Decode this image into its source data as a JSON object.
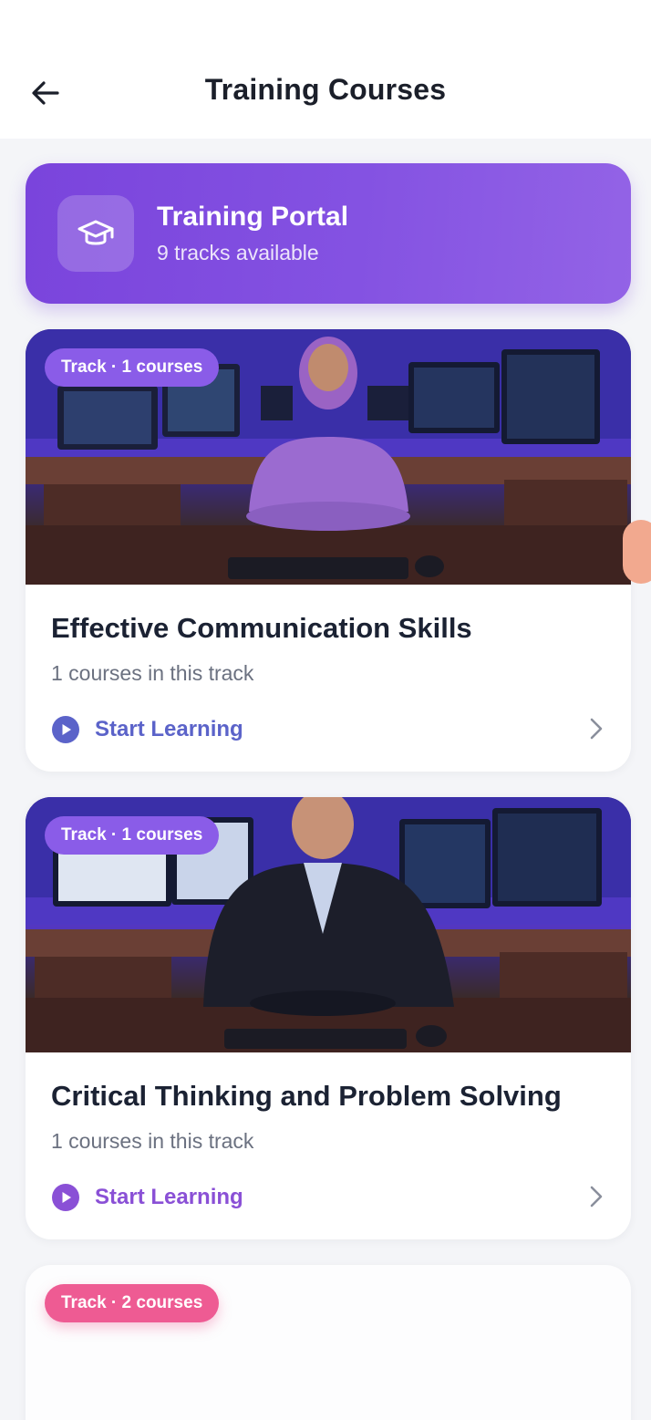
{
  "header": {
    "title": "Training Courses",
    "back_icon": "arrow-left-icon"
  },
  "portal": {
    "title": "Training Portal",
    "subtitle": "9 tracks available",
    "icon": "graduation-cap-icon",
    "color_start": "#7a44dc",
    "color_end": "#9363e6"
  },
  "tracks": [
    {
      "badge": "Track · 1 courses",
      "title": "Effective Communication Skills",
      "count": "1 courses in this track",
      "cta": "Start Learning",
      "cta_color": "#5b63c9",
      "badge_color": "#8a5ce8"
    },
    {
      "badge": "Track · 1 courses",
      "title": "Critical Thinking and Problem Solving",
      "count": "1 courses in this track",
      "cta": "Start Learning",
      "cta_color": "#8a50d6",
      "badge_color": "#8a5ce8"
    },
    {
      "badge": "Track · 2 courses",
      "badge_color": "#ee5b93"
    }
  ],
  "icons": {
    "play": "play-circle-icon",
    "chevron": "chevron-right-icon"
  }
}
